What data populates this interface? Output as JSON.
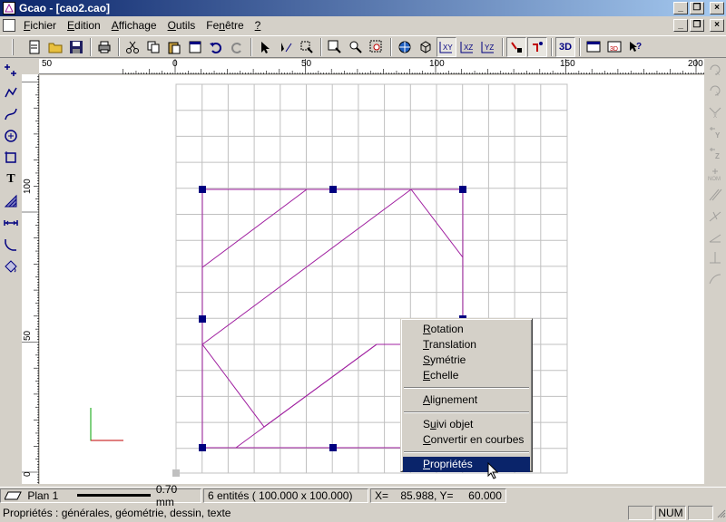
{
  "window": {
    "title": "Gcao - [cao2.cao]"
  },
  "menu": {
    "items": [
      {
        "label": "Fichier",
        "ul": "F"
      },
      {
        "label": "Edition",
        "ul": "E"
      },
      {
        "label": "Affichage",
        "ul": "A"
      },
      {
        "label": "Outils",
        "ul": "O"
      },
      {
        "label": "Fenêtre",
        "ul": "n"
      },
      {
        "label": "?",
        "ul": "?"
      }
    ]
  },
  "toolbar": {
    "view_3d_label": "3D",
    "plane_xy": "XY",
    "plane_xz": "XZ",
    "plane_yz": "YZ"
  },
  "ruler": {
    "h_labels": [
      "50",
      "0",
      "50",
      "100",
      "150",
      "200"
    ],
    "v_labels": [
      "100",
      "50",
      "0"
    ]
  },
  "context_menu": {
    "items": [
      "Rotation",
      "Translation",
      "Symétrie",
      "Echelle",
      "Alignement",
      "Suivi objet",
      "Convertir en courbes",
      "Propriétés"
    ],
    "highlighted": "Propriétés"
  },
  "statusbar": {
    "layer": "Plan 1",
    "line_width": "0.70 mm",
    "entities": "6 entités ( 100.000 x  100.000)",
    "coords": "X=    85.988, Y=     60.000",
    "hint": "Propriétés : générales, géométrie, dessin, texte",
    "num": "NUM"
  },
  "colors": {
    "shape": "#a020a0",
    "handle": "#000080",
    "grid": "#c0c0c0",
    "highlight": "#0a246a"
  }
}
